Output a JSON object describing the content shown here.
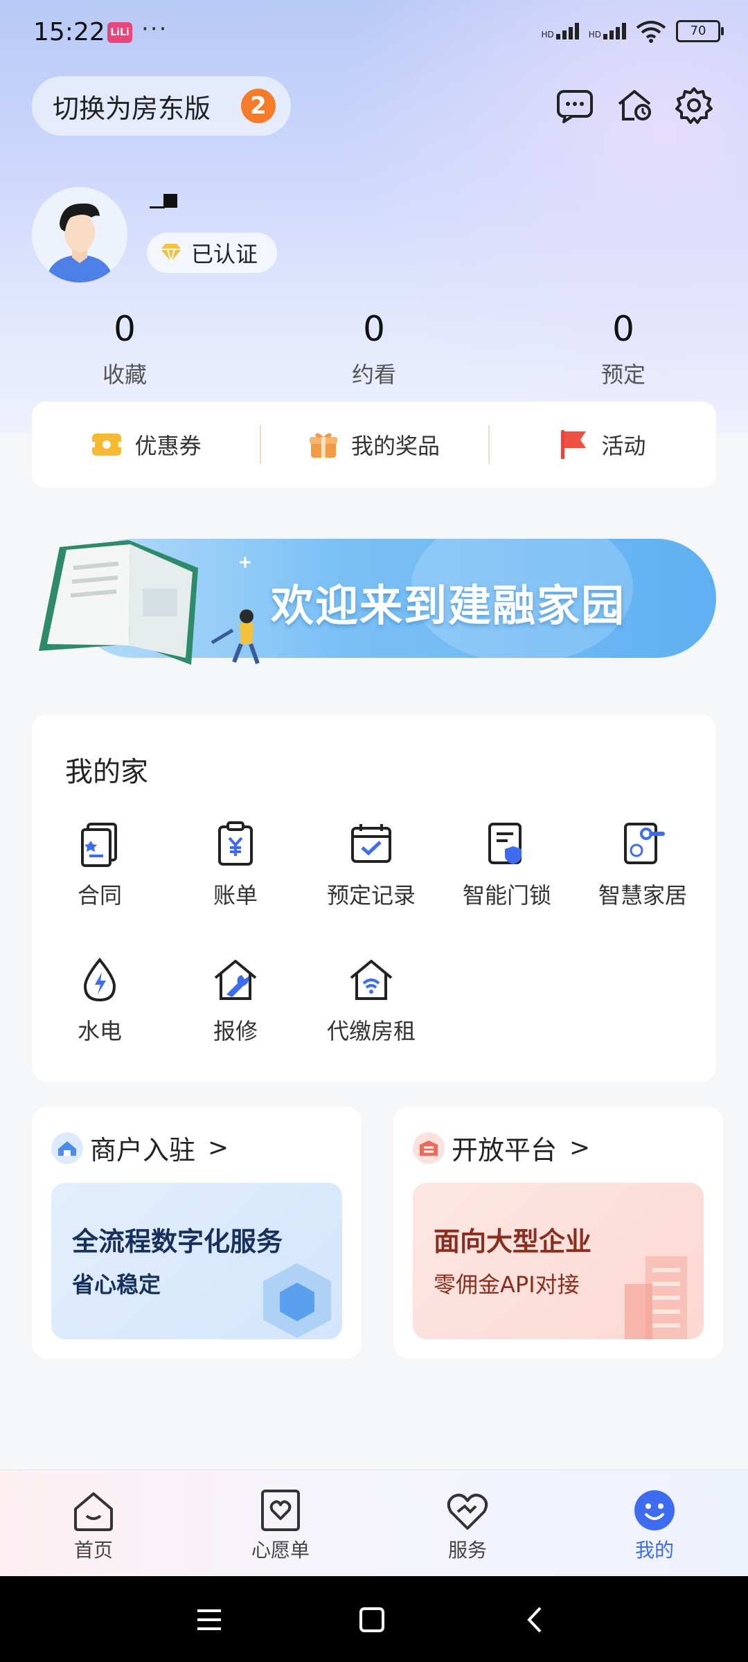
{
  "status_bar": {
    "time": "15:22",
    "app_badge": "LiLi",
    "more": "···",
    "signal1": "HD",
    "signal2": "HD",
    "battery": "70"
  },
  "header": {
    "switch_label": "切换为房东版",
    "switch_badge": "2"
  },
  "profile": {
    "name": "._",
    "verified_label": "已认证"
  },
  "stats": [
    {
      "value": "0",
      "label": "收藏"
    },
    {
      "value": "0",
      "label": "约看"
    },
    {
      "value": "0",
      "label": "预定"
    }
  ],
  "quick_links": [
    {
      "label": "优惠券",
      "icon": "coupon-icon"
    },
    {
      "label": "我的奖品",
      "icon": "gift-icon"
    },
    {
      "label": "活动",
      "icon": "flag-icon"
    }
  ],
  "banner": {
    "text": "欢迎来到建融家园"
  },
  "my_home": {
    "title": "我的家",
    "items": [
      {
        "label": "合同",
        "icon": "contract-icon"
      },
      {
        "label": "账单",
        "icon": "bill-icon"
      },
      {
        "label": "预定记录",
        "icon": "calendar-check-icon"
      },
      {
        "label": "智能门锁",
        "icon": "smart-lock-icon"
      },
      {
        "label": "智慧家居",
        "icon": "smart-home-icon"
      },
      {
        "label": "水电",
        "icon": "water-electric-icon"
      },
      {
        "label": "报修",
        "icon": "repair-icon"
      },
      {
        "label": "代缴房租",
        "icon": "rent-pay-icon"
      }
    ]
  },
  "promos": [
    {
      "title": "商户入驻",
      "chevron": ">",
      "line1": "全流程数字化服务",
      "line2": "省心稳定",
      "icon": "merchant-icon"
    },
    {
      "title": "开放平台",
      "chevron": ">",
      "line1": "面向大型企业",
      "line2": "零佣金API对接",
      "icon": "platform-icon"
    }
  ],
  "tabs": [
    {
      "label": "首页",
      "icon": "home-icon"
    },
    {
      "label": "心愿单",
      "icon": "wishlist-icon"
    },
    {
      "label": "服务",
      "icon": "service-icon"
    },
    {
      "label": "我的",
      "icon": "profile-smile-icon",
      "active": true
    }
  ],
  "colors": {
    "accent": "#3d6cf0",
    "badge_orange": "#f47b2a",
    "promo_red_text": "#8a2d1c",
    "promo_blue_text": "#17305e"
  }
}
